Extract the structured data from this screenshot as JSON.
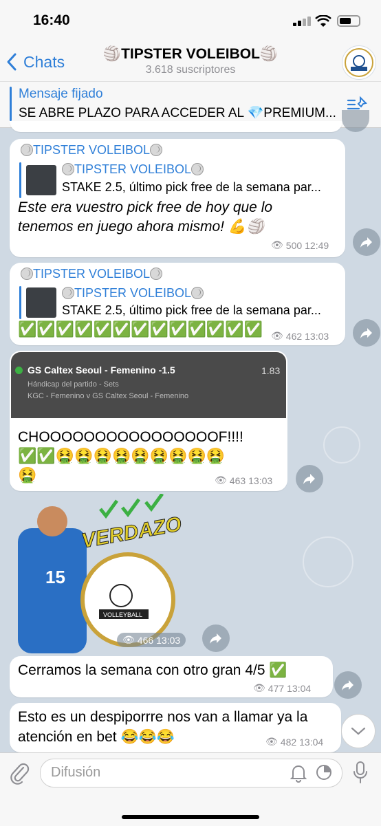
{
  "status": {
    "time": "16:40"
  },
  "header": {
    "back_label": "Chats",
    "title": "🏐TIPSTER VOLEIBOL🏐",
    "subtitle": "3.618 suscriptores"
  },
  "pinned": {
    "label": "Mensaje fijado",
    "text": "SE ABRE PLAZO PARA ACCEDER AL 💎PREMIUM..."
  },
  "messages": {
    "m1": {
      "sender": "TIPSTER VOLEIBOL",
      "quote_sender": "TIPSTER VOLEIBOL",
      "quote_text": "STAKE 2.5, último pick free de la semana par...",
      "text_line1": "Este era vuestro pick free de hoy que lo",
      "text_line2": "tenemos en juego ahora mismo! 💪🏐",
      "views": "500",
      "time": "12:49"
    },
    "m2": {
      "sender": "TIPSTER VOLEIBOL",
      "quote_sender": "TIPSTER VOLEIBOL",
      "quote_text": "STAKE 2.5, último pick free de la semana par...",
      "text": "✅✅✅✅✅✅✅✅✅✅✅✅✅",
      "views": "462",
      "time": "13:03"
    },
    "m3": {
      "bet_title": "GS Caltex Seoul - Femenino -1.5",
      "bet_odds": "1.83",
      "bet_market": "Hándicap del partido - Sets",
      "bet_match": "KGC - Femenino v GS Caltex Seoul - Femenino",
      "text_line1": "CHOOOOOOOOOOOOOOOOF!!!!",
      "text_line2": "✅✅🤮🤮🤮🤮🤮🤮🤮🤮🤮",
      "text_line3": "🤮",
      "views": "463",
      "time": "13:03"
    },
    "m4": {
      "sticker_text": "VERDAZO",
      "player_number": "15",
      "logo_text": "VOLLEYBALL",
      "views": "466",
      "time": "13:03"
    },
    "m5": {
      "text": "Cerramos la semana con otro gran 4/5 ✅",
      "views": "477",
      "time": "13:04"
    },
    "m6": {
      "text_line1": "Esto es un despiporrre nos van a llamar ya la",
      "text_line2": "atención en bet 😂😂😂",
      "views": "482",
      "time": "13:04"
    }
  },
  "composer": {
    "placeholder": "Difusión"
  },
  "colors": {
    "accent": "#2f7fd8",
    "bubble": "#ffffff",
    "chat_bg": "#cfd9e3"
  }
}
